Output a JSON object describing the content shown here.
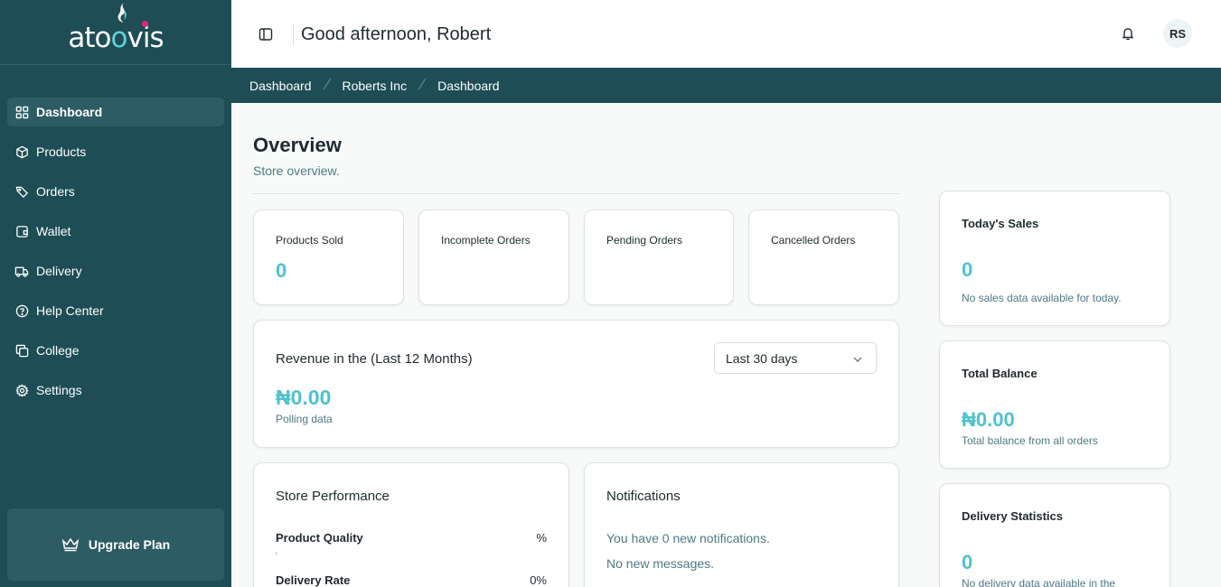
{
  "brand": {
    "name_part1": "at",
    "name_o1": "o",
    "name_o2": "o",
    "name_part2": "vis",
    "accent": "#5fd0d9",
    "dot_color": "#e1257f"
  },
  "sidebar": {
    "items": [
      {
        "label": "Dashboard",
        "icon": "grid-icon",
        "active": true
      },
      {
        "label": "Products",
        "icon": "box-icon",
        "active": false
      },
      {
        "label": "Orders",
        "icon": "tag-icon",
        "active": false
      },
      {
        "label": "Wallet",
        "icon": "wallet-icon",
        "active": false
      },
      {
        "label": "Delivery",
        "icon": "truck-icon",
        "active": false
      },
      {
        "label": "Help Center",
        "icon": "help-circle-icon",
        "active": false
      },
      {
        "label": "College",
        "icon": "copy-icon",
        "active": false
      },
      {
        "label": "Settings",
        "icon": "gear-icon",
        "active": false
      }
    ],
    "upgrade_label": "Upgrade Plan"
  },
  "header": {
    "greeting": "Good afternoon, Robert",
    "avatar_initials": "RS"
  },
  "breadcrumb": [
    "Dashboard",
    "Roberts Inc",
    "Dashboard"
  ],
  "overview": {
    "title": "Overview",
    "subtitle": "Store overview."
  },
  "stats": [
    {
      "label": "Products Sold",
      "value": "0"
    },
    {
      "label": "Incomplete Orders",
      "value": ""
    },
    {
      "label": "Pending Orders",
      "value": ""
    },
    {
      "label": "Cancelled Orders",
      "value": ""
    }
  ],
  "revenue": {
    "label": "Revenue in the (Last 12 Months)",
    "select_value": "Last 30 days",
    "amount": "₦0.00",
    "sub": "Polling data"
  },
  "performance": {
    "title": "Store Performance",
    "rows": [
      {
        "label": "Product Quality",
        "value": "%"
      },
      {
        "label": "Delivery Rate",
        "value": "0%"
      }
    ]
  },
  "notifications": {
    "title": "Notifications",
    "line1": "You have 0 new notifications.",
    "line2": "No new messages."
  },
  "side_cards": {
    "today_sales": {
      "title": "Today's Sales",
      "value": "0",
      "sub": "No sales data available for today."
    },
    "total_balance": {
      "title": "Total Balance",
      "value": "₦0.00",
      "sub": "Total balance from all orders"
    },
    "delivery_stats": {
      "title": "Delivery Statistics",
      "value": "0",
      "sub": "No delivery data available in the"
    }
  }
}
